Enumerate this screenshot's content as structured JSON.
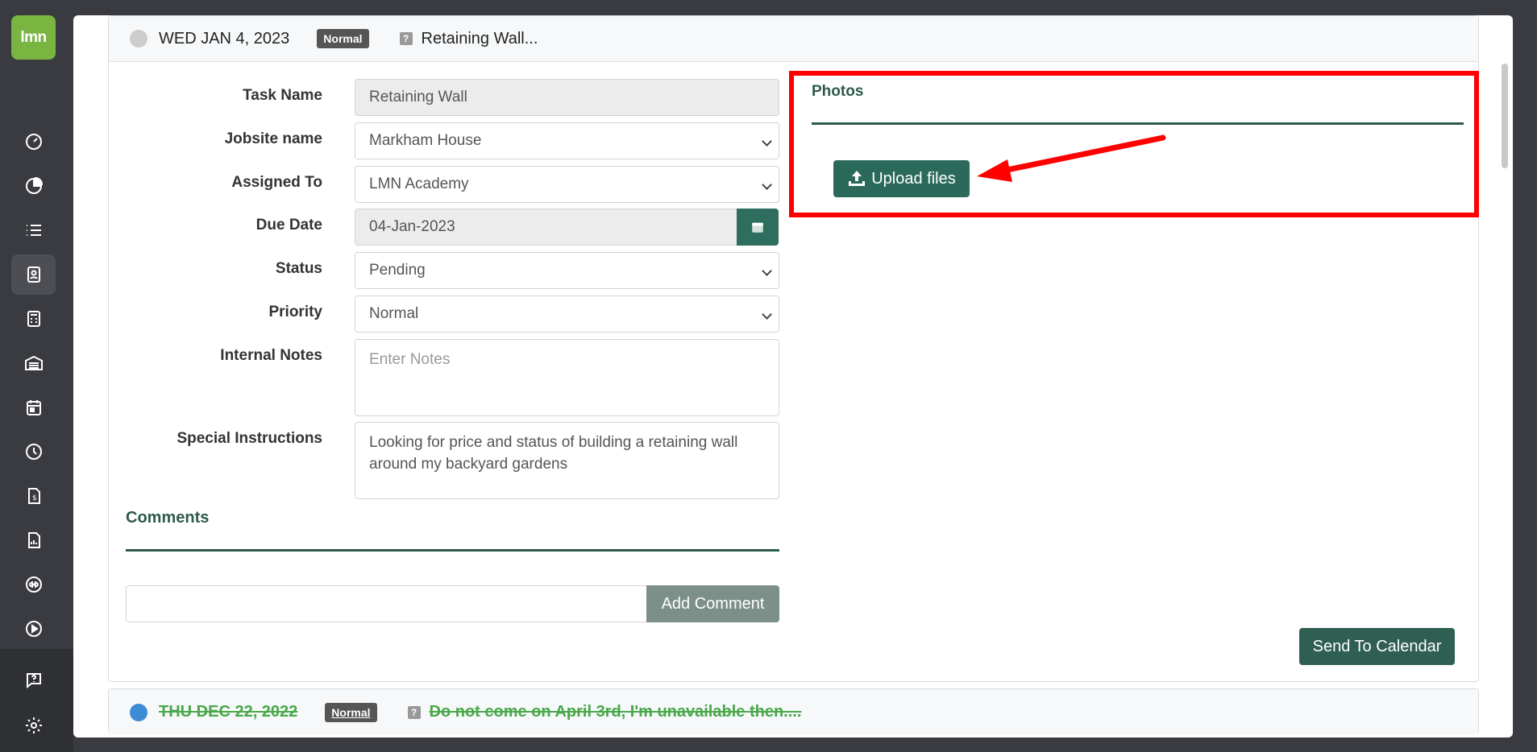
{
  "app": {
    "logo_text": "lmn"
  },
  "nav": {
    "items": [
      {
        "icon": "gauge-icon"
      },
      {
        "icon": "pie-chart-icon"
      },
      {
        "icon": "list-icon"
      },
      {
        "icon": "contact-card-icon",
        "active": true
      },
      {
        "icon": "calculator-icon"
      },
      {
        "icon": "warehouse-icon"
      },
      {
        "icon": "calendar-icon"
      },
      {
        "icon": "clock-icon"
      },
      {
        "icon": "invoice-icon"
      },
      {
        "icon": "report-icon"
      },
      {
        "icon": "quickbooks-icon"
      },
      {
        "icon": "play-icon"
      }
    ],
    "bottom": [
      {
        "icon": "help-chat-icon"
      },
      {
        "icon": "gear-icon"
      }
    ]
  },
  "task": {
    "date": "WED JAN 4, 2023",
    "priority_badge": "Normal",
    "title": "Retaining Wall...",
    "form": {
      "task_name_label": "Task Name",
      "task_name_value": "Retaining Wall",
      "jobsite_label": "Jobsite name",
      "jobsite_value": "Markham House",
      "assigned_label": "Assigned To",
      "assigned_value": "LMN Academy",
      "due_label": "Due Date",
      "due_value": "04-Jan-2023",
      "status_label": "Status",
      "status_value": "Pending",
      "priority_label": "Priority",
      "priority_value": "Normal",
      "notes_label": "Internal Notes",
      "notes_placeholder": "Enter Notes",
      "special_label": "Special Instructions",
      "special_value": "Looking for price and status of building a retaining wall around my backyard gardens"
    },
    "comments": {
      "title": "Comments",
      "add_label": "Add Comment"
    },
    "photos": {
      "title": "Photos",
      "upload_label": "Upload files"
    },
    "send_label": "Send To Calendar"
  },
  "next_task": {
    "date": "THU DEC 22, 2022",
    "priority_badge": "Normal",
    "title": "Do not come on April 3rd, I'm unavailable then...."
  },
  "annotation": {
    "color": "#ff0000"
  }
}
